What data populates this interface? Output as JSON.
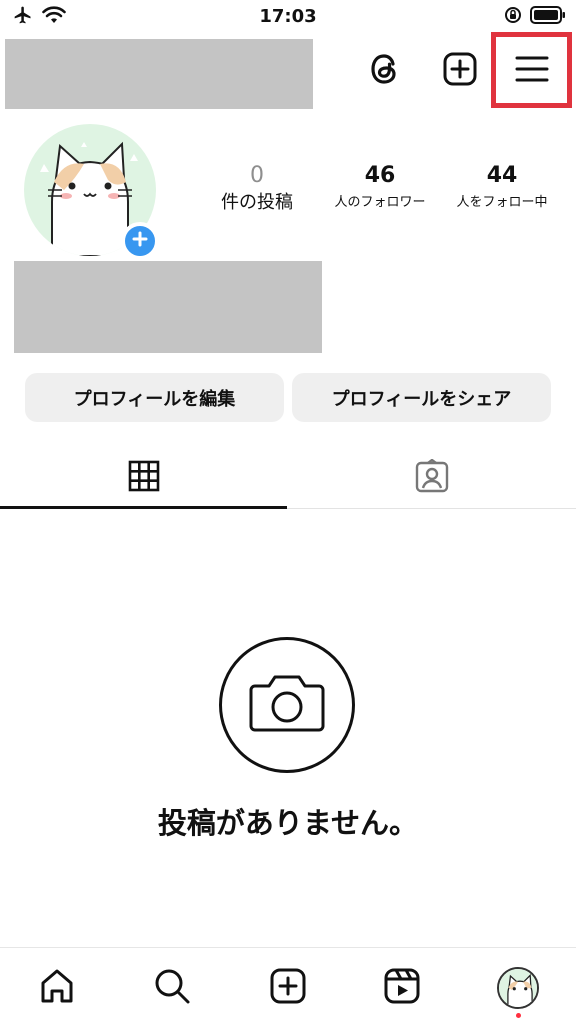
{
  "status_bar": {
    "time": "17:03",
    "icons": [
      "airplane-mode-icon",
      "wifi-icon",
      "orientation-lock-icon",
      "battery-icon"
    ]
  },
  "header": {
    "icons": [
      "threads-icon",
      "create-icon",
      "menu-icon"
    ],
    "highlight_color": "#e0333e"
  },
  "profile": {
    "avatar_add_color": "#3897f0",
    "stats": {
      "posts": {
        "value": "0",
        "label": "件の投稿"
      },
      "followers": {
        "value": "46",
        "label": "人のフォロワー"
      },
      "following": {
        "value": "44",
        "label": "人をフォロー中"
      }
    }
  },
  "actions": {
    "edit_label": "プロフィールを編集",
    "share_label": "プロフィールをシェア"
  },
  "tabs": {
    "icons": [
      "grid-icon",
      "tagged-user-icon"
    ],
    "active_index": 0
  },
  "empty_state": {
    "icon": "camera-icon",
    "text": "投稿がありません。"
  },
  "bottom_nav": {
    "items": [
      "home-icon",
      "search-icon",
      "create-icon",
      "reels-icon",
      "profile-avatar"
    ],
    "notification_dot_color": "#ff3040"
  }
}
